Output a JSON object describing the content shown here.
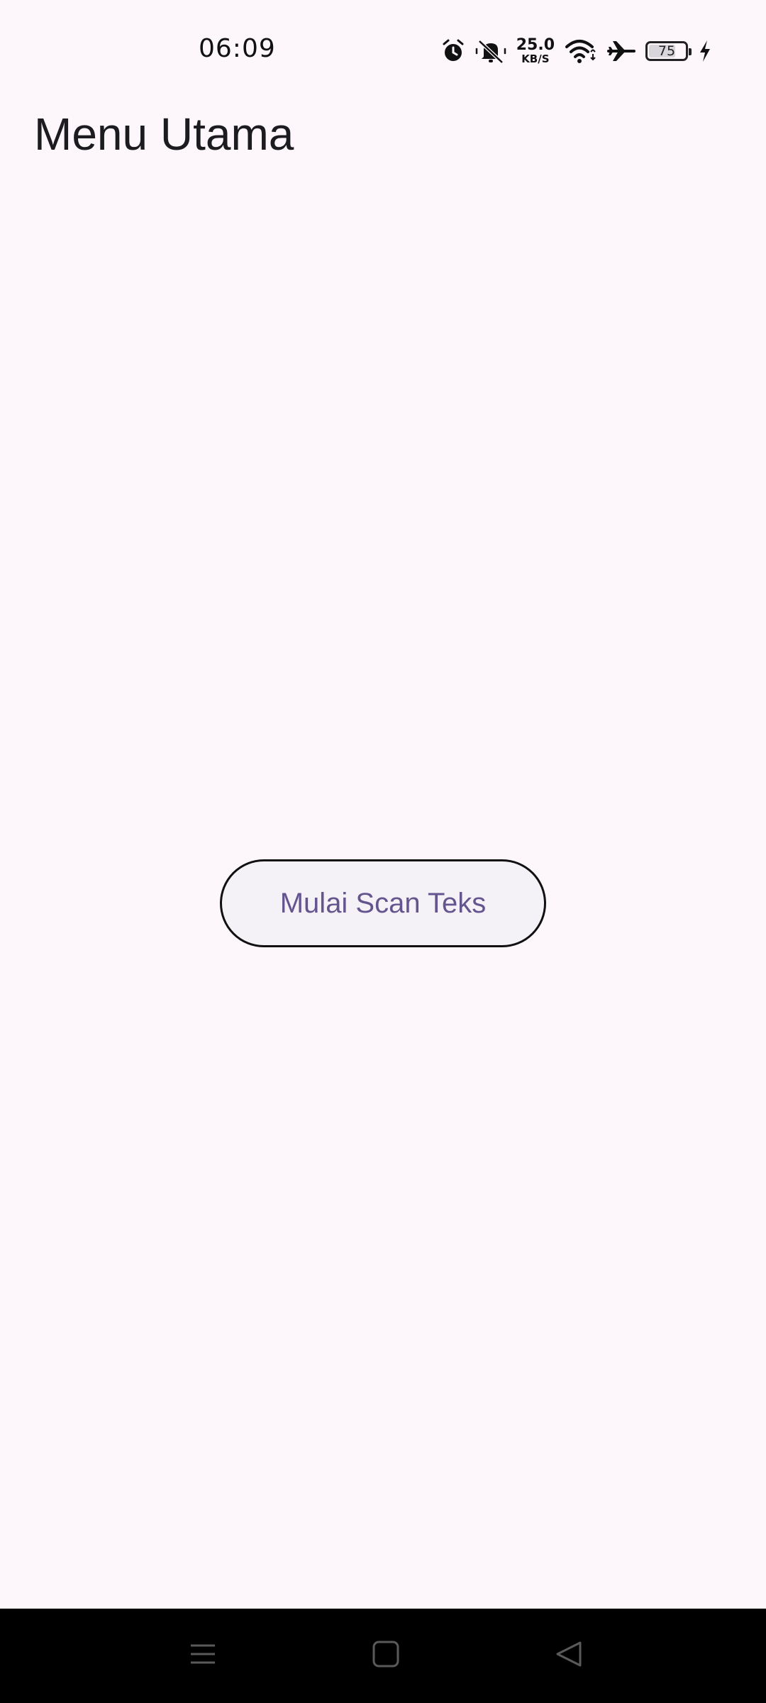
{
  "status_bar": {
    "time": "06:09",
    "net_speed_value": "25.0",
    "net_speed_unit": "KB/S",
    "battery_level": "75",
    "icons": [
      "alarm-icon",
      "mute-icon",
      "wifi-icon",
      "airplane-mode-icon",
      "battery-icon",
      "charging-icon"
    ]
  },
  "header": {
    "title": "Menu Utama"
  },
  "main": {
    "scan_button_label": "Mulai Scan Teks"
  },
  "nav_bar": {
    "icons": [
      "menu-icon",
      "home-icon",
      "back-icon"
    ]
  },
  "colors": {
    "background": "#fdf7fc",
    "button_text": "#65558f",
    "button_fill": "#f5f2f7",
    "nav_bar": "#000000"
  }
}
